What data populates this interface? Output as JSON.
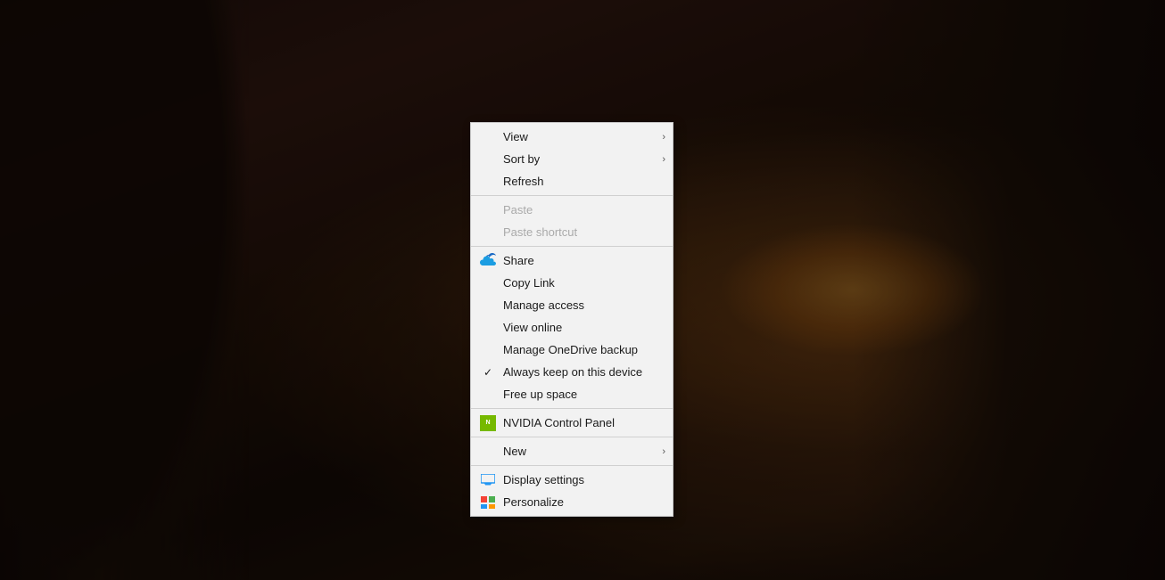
{
  "desktop": {
    "background_description": "Dark moody night landscape with city lights"
  },
  "context_menu": {
    "items": [
      {
        "id": "view",
        "label": "View",
        "has_arrow": true,
        "disabled": false,
        "icon": null,
        "has_check": false
      },
      {
        "id": "sort_by",
        "label": "Sort by",
        "has_arrow": true,
        "disabled": false,
        "icon": null,
        "has_check": false
      },
      {
        "id": "refresh",
        "label": "Refresh",
        "has_arrow": false,
        "disabled": false,
        "icon": null,
        "has_check": false
      },
      {
        "id": "sep1",
        "type": "separator"
      },
      {
        "id": "paste",
        "label": "Paste",
        "has_arrow": false,
        "disabled": true,
        "icon": null,
        "has_check": false
      },
      {
        "id": "paste_shortcut",
        "label": "Paste shortcut",
        "has_arrow": false,
        "disabled": true,
        "icon": null,
        "has_check": false
      },
      {
        "id": "sep2",
        "type": "separator"
      },
      {
        "id": "share",
        "label": "Share",
        "has_arrow": false,
        "disabled": false,
        "icon": "onedrive",
        "has_check": false
      },
      {
        "id": "copy_link",
        "label": "Copy Link",
        "has_arrow": false,
        "disabled": false,
        "icon": null,
        "has_check": false
      },
      {
        "id": "manage_access",
        "label": "Manage access",
        "has_arrow": false,
        "disabled": false,
        "icon": null,
        "has_check": false
      },
      {
        "id": "view_online",
        "label": "View online",
        "has_arrow": false,
        "disabled": false,
        "icon": null,
        "has_check": false
      },
      {
        "id": "manage_onedrive",
        "label": "Manage OneDrive backup",
        "has_arrow": false,
        "disabled": false,
        "icon": null,
        "has_check": false
      },
      {
        "id": "always_keep",
        "label": "Always keep on this device",
        "has_arrow": false,
        "disabled": false,
        "icon": null,
        "has_check": true
      },
      {
        "id": "free_up_space",
        "label": "Free up space",
        "has_arrow": false,
        "disabled": false,
        "icon": null,
        "has_check": false
      },
      {
        "id": "sep3",
        "type": "separator"
      },
      {
        "id": "nvidia",
        "label": "NVIDIA Control Panel",
        "has_arrow": false,
        "disabled": false,
        "icon": "nvidia",
        "has_check": false
      },
      {
        "id": "sep4",
        "type": "separator"
      },
      {
        "id": "new",
        "label": "New",
        "has_arrow": true,
        "disabled": false,
        "icon": null,
        "has_check": false
      },
      {
        "id": "sep5",
        "type": "separator"
      },
      {
        "id": "display_settings",
        "label": "Display settings",
        "has_arrow": false,
        "disabled": false,
        "icon": "display",
        "has_check": false
      },
      {
        "id": "personalize",
        "label": "Personalize",
        "has_arrow": false,
        "disabled": false,
        "icon": "personalize",
        "has_check": false
      }
    ]
  }
}
